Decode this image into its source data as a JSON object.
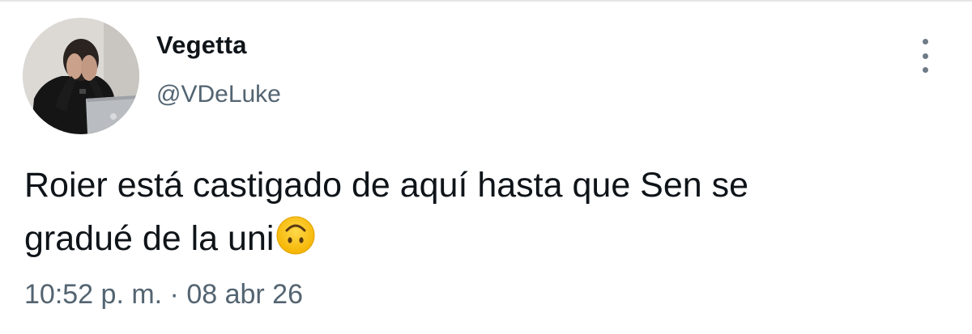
{
  "tweet": {
    "display_name": "Vegetta",
    "handle": "@VDeLuke",
    "text_line1": "Roier está castigado de aquí hasta que Sen se",
    "text_line2": "gradué de la uni",
    "emoji": "upside-down-face",
    "time": "10:52 p. m.",
    "separator": " · ",
    "date": "08 abr 26"
  },
  "icons": {
    "more": "more-vertical-icon"
  },
  "colors": {
    "primary_text": "#0f1419",
    "secondary_text": "#536471",
    "background": "#ffffff"
  }
}
